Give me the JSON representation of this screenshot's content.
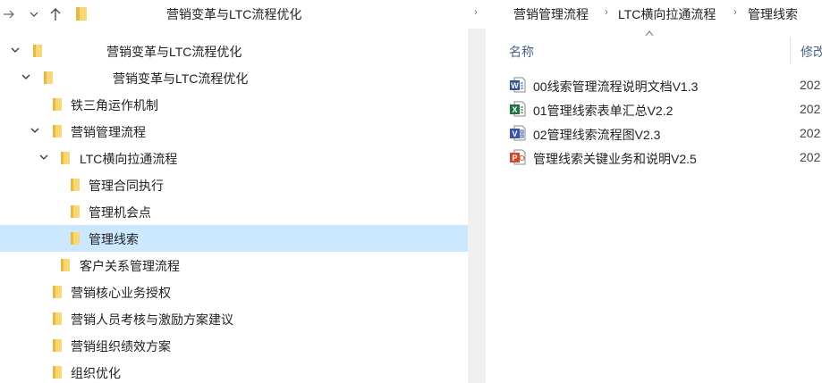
{
  "address_bar": {
    "title": "营销变革与LTC流程优化",
    "breadcrumb": [
      "营销管理流程",
      "LTC横向拉通流程",
      "管理线索"
    ]
  },
  "tree": [
    {
      "label": "营销变革与LTC流程优化",
      "state": "expanded"
    },
    {
      "label": "营销变革与LTC流程优化",
      "state": "expanded"
    },
    {
      "label": "铁三角运作机制",
      "state": "leaf"
    },
    {
      "label": "营销管理流程",
      "state": "expanded"
    },
    {
      "label": "LTC横向拉通流程",
      "state": "expanded"
    },
    {
      "label": "管理合同执行",
      "state": "leaf"
    },
    {
      "label": "管理机会点",
      "state": "leaf"
    },
    {
      "label": "管理线索",
      "state": "selected"
    },
    {
      "label": "客户关系管理流程",
      "state": "leaf"
    },
    {
      "label": "营销核心业务授权",
      "state": "leaf"
    },
    {
      "label": "营销人员考核与激励方案建议",
      "state": "leaf"
    },
    {
      "label": "营销组织绩效方案",
      "state": "leaf"
    },
    {
      "label": "组织优化",
      "state": "leaf"
    }
  ],
  "file_list": {
    "columns": {
      "name": "名称",
      "modified": "修改"
    },
    "files": [
      {
        "name": "00线索管理流程说明文档V1.3",
        "date": "202",
        "icon": "word-doc-icon"
      },
      {
        "name": "01管理线索表单汇总V2.2",
        "date": "202",
        "icon": "excel-sheet-icon"
      },
      {
        "name": "02管理线索流程图V2.3",
        "date": "202",
        "icon": "visio-diagram-icon"
      },
      {
        "name": "管理线索关键业务和说明V2.5",
        "date": "202",
        "icon": "powerpoint-icon"
      }
    ]
  },
  "colors": {
    "selection": "#cce8ff",
    "folder": "#f8d775",
    "word": "#2b579a",
    "excel": "#217346",
    "visio": "#3955a3",
    "powerpoint": "#d24726"
  }
}
